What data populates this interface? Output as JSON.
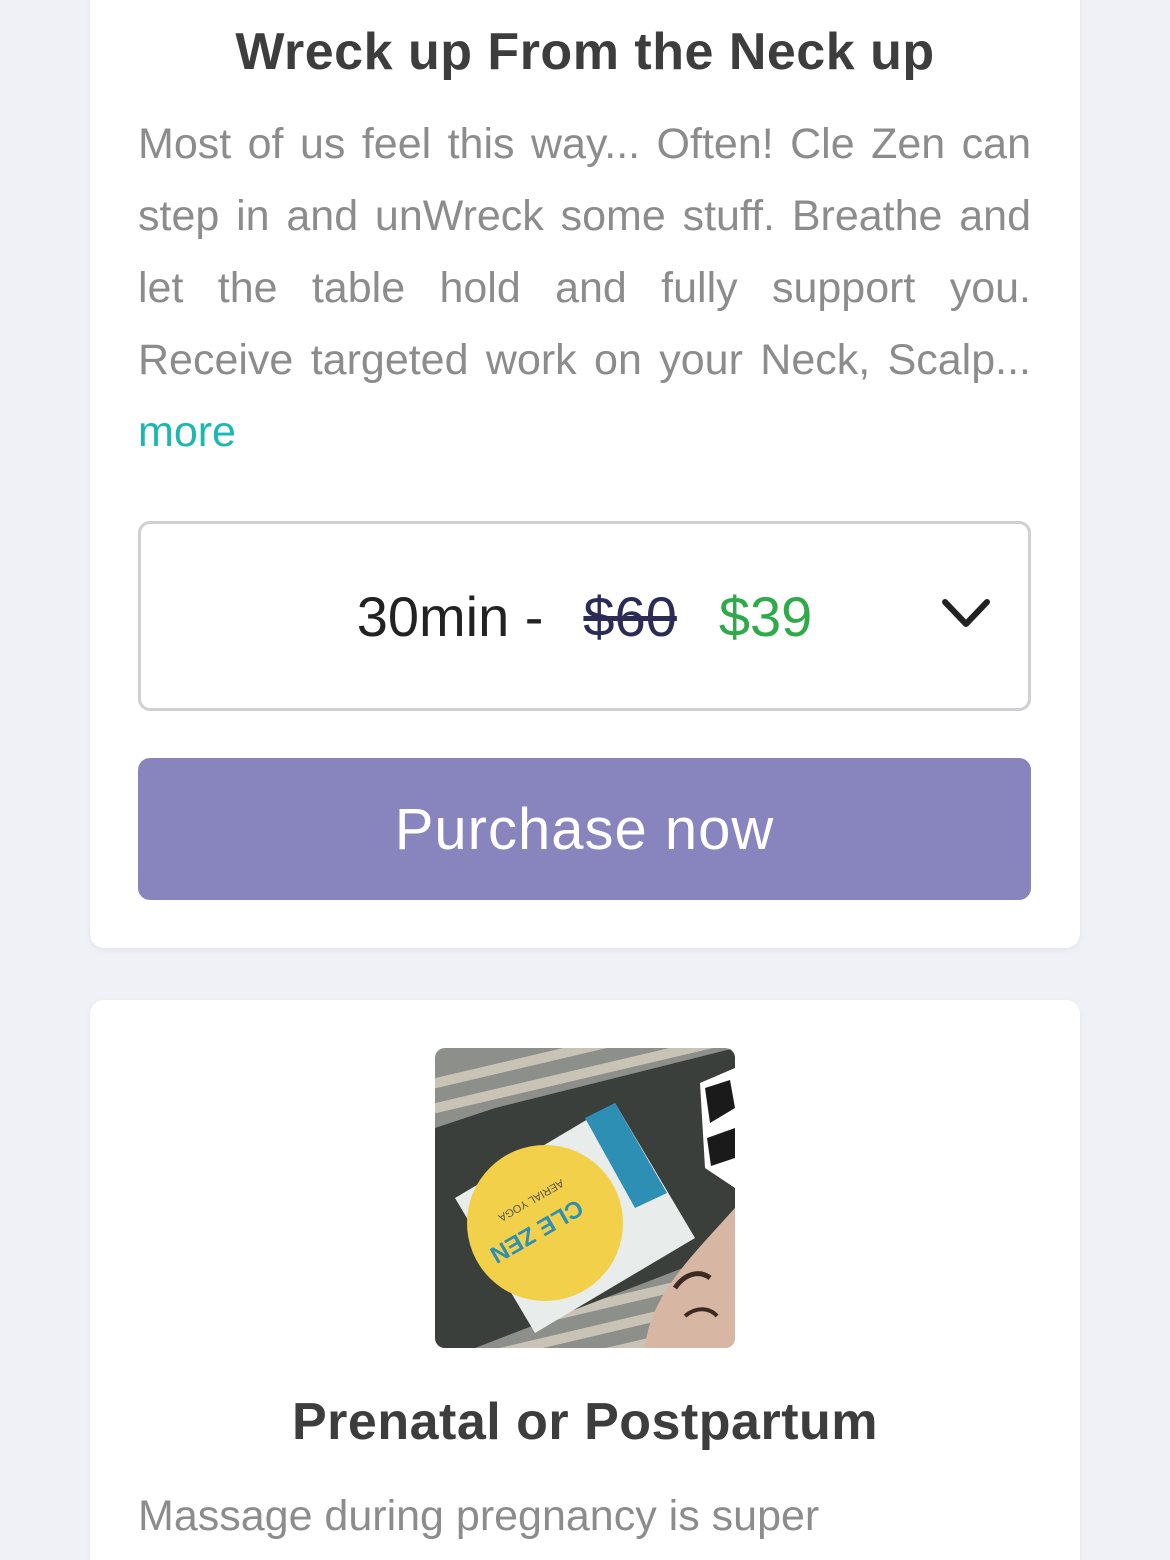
{
  "card1": {
    "title": "Wreck up From the Neck up",
    "description": "Most of us feel this way... Often! Cle Zen can step in and unWreck some stuff. Breathe and let the table hold and fully support you. Receive targeted work on your Neck, Scalp...",
    "more_label": "more",
    "select": {
      "duration": "30min -",
      "old_price": "$60",
      "new_price": "$39"
    },
    "purchase_label": "Purchase now"
  },
  "card2": {
    "image_text": "CLE ZEN",
    "image_subtext": "AERIAL YOGA",
    "title": "Prenatal or Postpartum",
    "description": "Massage during pregnancy is super"
  },
  "colors": {
    "accent_link": "#1bb7b1",
    "purchase_button": "#8884be",
    "new_price": "#2eaa4a",
    "old_price": "#2b2b55",
    "background": "#f0f0f7"
  }
}
